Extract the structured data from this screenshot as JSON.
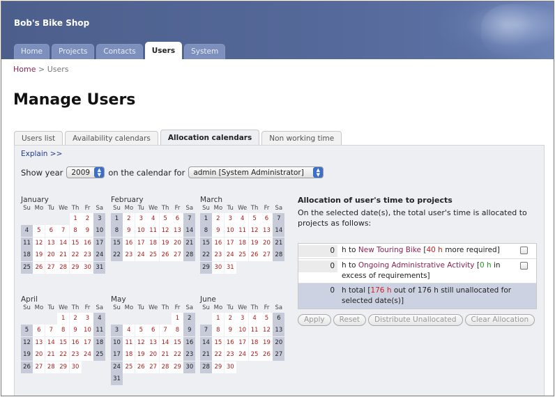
{
  "app": {
    "title": "Bob's Bike Shop"
  },
  "main_tabs": [
    "Home",
    "Projects",
    "Contacts",
    "Users",
    "System"
  ],
  "breadcrumb": {
    "home": "Home",
    "separator": ">",
    "current": "Users"
  },
  "page_title": "Manage Users",
  "sub_tabs": [
    "Users list",
    "Availability calendars",
    "Allocation calendars",
    "Non working time"
  ],
  "explain_link": "Explain >>",
  "year_row": {
    "label_before": "Show year",
    "year": "2009",
    "label_after": "on the calendar for",
    "user": "admin [System Administrator]"
  },
  "weekday_headers": [
    "Su",
    "Mo",
    "Tu",
    "We",
    "Th",
    "Fr",
    "Sa"
  ],
  "months": [
    {
      "name": "January",
      "start": 4,
      "days": 31
    },
    {
      "name": "February",
      "start": 0,
      "days": 28
    },
    {
      "name": "March",
      "start": 0,
      "days": 31
    },
    {
      "name": "April",
      "start": 3,
      "days": 30
    },
    {
      "name": "May",
      "start": 5,
      "days": 31
    },
    {
      "name": "June",
      "start": 1,
      "days": 30
    }
  ],
  "allocation": {
    "heading": "Allocation of user's time to projects",
    "description": "On the selected date(s), the total user's time is allocated to projects as follows:",
    "rows": [
      {
        "hours": "0",
        "to": "h to",
        "project": "New Touring Bike",
        "bracket_open": "[",
        "amount": "40 h",
        "note": "more required]"
      },
      {
        "hours": "0",
        "to": "h to",
        "project": "Ongoing Administrative Activity",
        "bracket_open": "[",
        "amount": "0 h",
        "note": "in excess of requirements]"
      }
    ],
    "total": {
      "hours": "0",
      "label": "h total [",
      "amount": "176 h",
      "note": "out of 176 h still unallocated for selected date(s)]"
    }
  },
  "buttons": [
    "Apply",
    "Reset",
    "Distribute Unallocated",
    "Clear Allocation"
  ],
  "colors": {
    "header": "#55699a",
    "project_link": "#8e2154",
    "weekday_text": "#b01818",
    "weekend_cell": "#c6cad9",
    "panel": "#eeeff3"
  }
}
